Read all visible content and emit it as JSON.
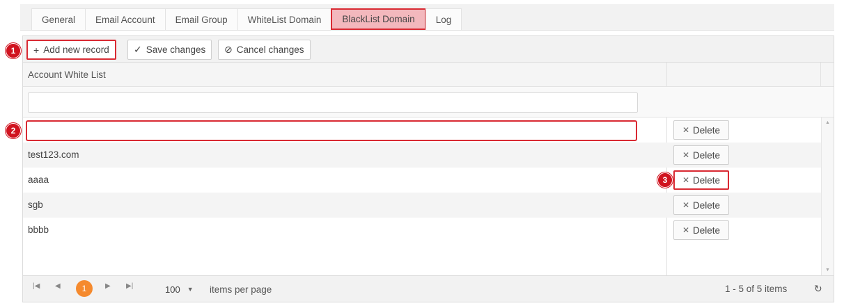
{
  "tabs": [
    {
      "label": "General"
    },
    {
      "label": "Email Account"
    },
    {
      "label": "Email Group"
    },
    {
      "label": "WhiteList Domain"
    },
    {
      "label": "BlackList Domain",
      "active": true
    },
    {
      "label": "Log"
    }
  ],
  "toolbar": {
    "add_label": "Add new record",
    "add_icon": "plus-icon",
    "save_label": "Save changes",
    "save_icon": "check-icon",
    "cancel_label": "Cancel changes",
    "cancel_icon": "cancel-icon"
  },
  "grid": {
    "column_header": "Account White List",
    "filter_value": "",
    "edit_value": "",
    "rows": [
      {
        "value": "test123.com"
      },
      {
        "value": "aaaa"
      },
      {
        "value": "sgb"
      },
      {
        "value": "bbbb"
      }
    ],
    "delete_label": "Delete"
  },
  "pager": {
    "current_page": "1",
    "page_size": "100",
    "items_per_page_label": "items per page",
    "info": "1 - 5 of 5 items"
  },
  "markers": [
    "1",
    "2",
    "3"
  ],
  "colors": {
    "highlight": "#d92a33",
    "marker": "#d0131f",
    "active_tab_bg": "#f3b8bd",
    "current_page": "#f58a2e"
  }
}
